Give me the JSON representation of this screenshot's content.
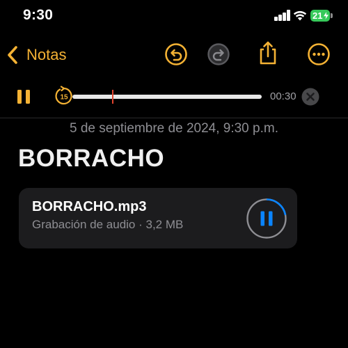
{
  "status": {
    "time": "9:30",
    "battery": "21"
  },
  "nav": {
    "back_label": "Notas",
    "icons": [
      "undo-icon",
      "redo-icon",
      "share-icon",
      "more-icon"
    ]
  },
  "player": {
    "skip_seconds": "15",
    "duration": "00:30",
    "progress_fraction": 0.21
  },
  "note": {
    "date": "5 de septiembre de 2024, 9:30 p.m.",
    "title": "BORRACHO"
  },
  "attachment": {
    "file_name": "BORRACHO.mp3",
    "meta": "Grabación de audio · 3,2 MB",
    "playback_fraction": 0.22
  },
  "colors": {
    "accent": "#F4B234",
    "playback_blue": "#0A84FF",
    "marker_red": "#E3442D",
    "battery_green": "#36C95A"
  }
}
